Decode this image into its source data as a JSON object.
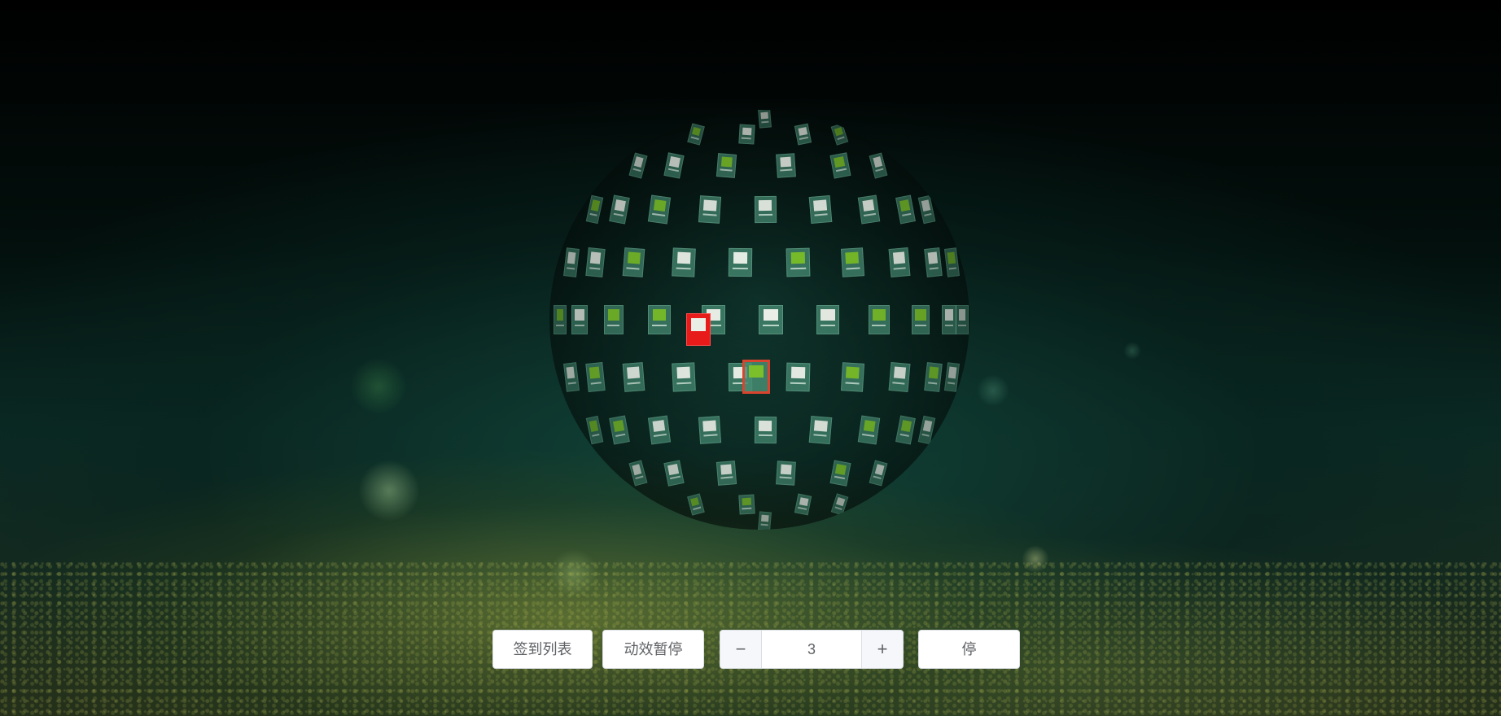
{
  "controls": {
    "signin_list_label": "签到列表",
    "pause_effect_label": "动效暂停",
    "stepper": {
      "value": "3",
      "decrement_symbol": "−",
      "increment_symbol": "+"
    },
    "stop_label": "停"
  },
  "colors": {
    "tile": "#468c73",
    "highlight_tile": "#e81b1b",
    "logo_green": "#7bbf2a"
  }
}
